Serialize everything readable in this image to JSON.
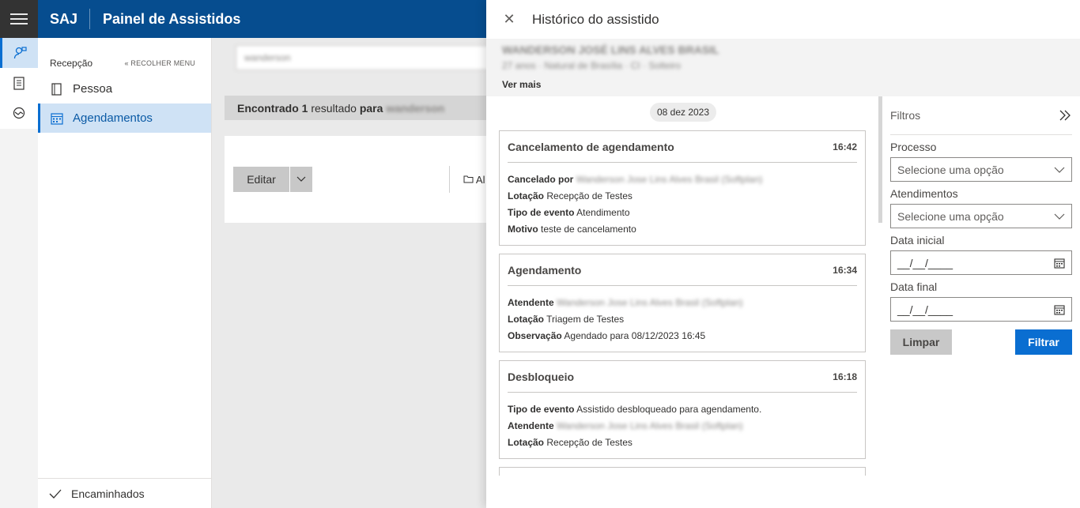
{
  "header": {
    "brand": "SAJ",
    "title": "Painel de Assistidos"
  },
  "rail": {
    "icons": [
      "person-icon",
      "clipboard-icon",
      "handshake-icon"
    ]
  },
  "sidemenu": {
    "title": "Recepção",
    "collapse_label": "« RECOLHER MENU",
    "items": [
      {
        "label": "Pessoa",
        "icon": "book-icon"
      },
      {
        "label": "Agendamentos",
        "icon": "calendar-icon"
      }
    ],
    "footer": "Encaminhados"
  },
  "main": {
    "search_value": "wanderson",
    "result": {
      "prefix": "Encontrado",
      "count": "1",
      "middle": "resultado",
      "para": "para",
      "term": "wanderson"
    },
    "edit_label": "Editar",
    "action_label": "Al"
  },
  "panel": {
    "title": "Histórico do assistido",
    "person_name": "WANDERSON JOSÉ LINS ALVES BRASIL",
    "person_details": "27 anos · Natural de Brasília · CI · Solteiro",
    "ver_mais": "Ver mais",
    "date": "08 dez 2023",
    "events": [
      {
        "title": "Cancelamento de agendamento",
        "time": "16:42",
        "fields": [
          {
            "label": "Cancelado por",
            "value": "Wanderson Jose Lins Alves Brasil (Softplan)",
            "blur": true
          },
          {
            "label": "Lotação",
            "value": "Recepção de Testes"
          },
          {
            "label": "Tipo de evento",
            "value": "Atendimento"
          },
          {
            "label": "Motivo",
            "value": "teste de cancelamento"
          }
        ]
      },
      {
        "title": "Agendamento",
        "time": "16:34",
        "fields": [
          {
            "label": "Atendente",
            "value": "Wanderson Jose Lins Alves Brasil (Softplan)",
            "blur": true
          },
          {
            "label": "Lotação",
            "value": "Triagem de Testes"
          },
          {
            "label": "Observação",
            "value": "Agendado para 08/12/2023 16:45"
          }
        ]
      },
      {
        "title": "Desbloqueio",
        "time": "16:18",
        "fields": [
          {
            "label": "Tipo de evento",
            "value": "Assistido desbloqueado para agendamento."
          },
          {
            "label": "Atendente",
            "value": "Wanderson Jose Lins Alves Brasil (Softplan)",
            "blur": true
          },
          {
            "label": "Lotação",
            "value": "Recepção de Testes"
          }
        ]
      }
    ],
    "filters": {
      "title": "Filtros",
      "processo_label": "Processo",
      "processo_placeholder": "Selecione uma opção",
      "atendimentos_label": "Atendimentos",
      "atendimentos_placeholder": "Selecione uma opção",
      "data_inicial_label": "Data inicial",
      "data_inicial_value": "__/__/____",
      "data_final_label": "Data final",
      "data_final_value": "__/__/____",
      "limpar": "Limpar",
      "filtrar": "Filtrar"
    }
  }
}
